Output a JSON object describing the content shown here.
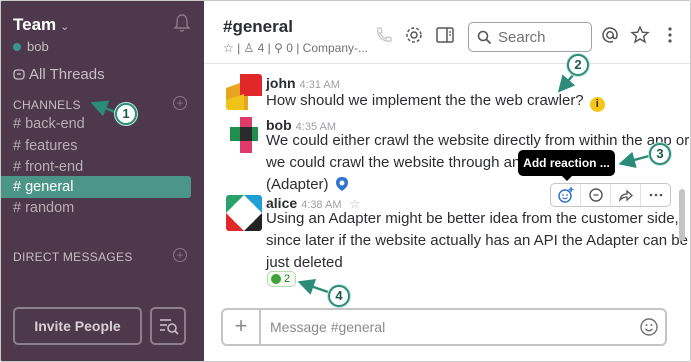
{
  "sidebar": {
    "team_name": "Team",
    "team_chevron": "⌄",
    "user": "bob",
    "all_threads": "All Threads",
    "channels_label": "CHANNELS",
    "channels": [
      "# back-end",
      "# features",
      "# front-end",
      "# general",
      "# random"
    ],
    "active_channel_index": 3,
    "direct_messages_label": "DIRECT MESSAGES",
    "invite_label": "Invite People"
  },
  "header": {
    "title": "#general",
    "meta": "☆ | ♙ 4 | ⚲ 0 | Company-...",
    "search_placeholder": "Search"
  },
  "messages": [
    {
      "user": "john",
      "time": "4:31 AM",
      "lines": [
        "How should we implement the the web crawler?"
      ]
    },
    {
      "user": "bob",
      "time": "4:35 AM",
      "lines": [
        "We could either crawl the website directly from within the app or",
        "we could crawl the website through an inter",
        "(Adapter)"
      ]
    },
    {
      "user": "alice",
      "time": "4:38 AM",
      "lines": [
        "Using an Adapter might be better idea from the customer side,",
        "since later if the website actually has an API the Adapter can be",
        "just deleted"
      ]
    }
  ],
  "tooltip": "Add reaction ...",
  "reaction": {
    "count": "2"
  },
  "composer": {
    "placeholder": "Message #general"
  },
  "callouts": [
    "1",
    "2",
    "3",
    "4"
  ],
  "colors": {
    "sidebar_bg": "#4d394b",
    "active_channel": "#4c9689",
    "callout_ring": "#2d8c79"
  }
}
